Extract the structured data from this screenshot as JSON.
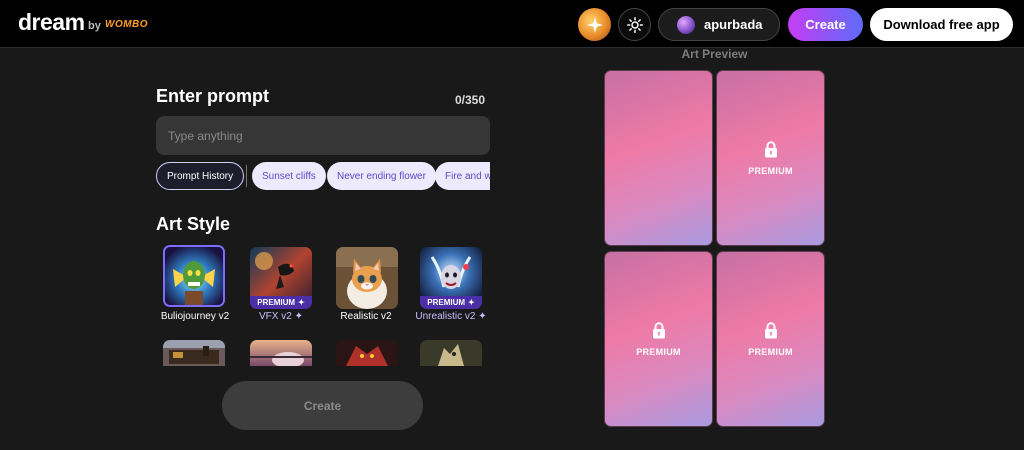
{
  "header": {
    "logo": "dream",
    "by": "by",
    "brand": "WOMBO",
    "username": "apurbada",
    "create_label": "Create",
    "download_label": "Download free app",
    "icons": [
      "sparkle-gem-icon",
      "sun-icon",
      "avatar"
    ]
  },
  "prompt": {
    "title": "Enter prompt",
    "counter": "0/350",
    "placeholder": "Type anything"
  },
  "chips": {
    "history": "Prompt History",
    "suggestions": [
      "Sunset cliffs",
      "Never ending flower",
      "Fire and w"
    ]
  },
  "art_style": {
    "title": "Art Style",
    "premium_label": "PREMIUM",
    "styles": [
      {
        "name": "Buliojourney v2",
        "premium": false,
        "selected": true
      },
      {
        "name": "VFX v2",
        "premium": true,
        "selected": false
      },
      {
        "name": "Realistic v2",
        "premium": false,
        "selected": false
      },
      {
        "name": "Unrealistic v2",
        "premium": true,
        "selected": false
      }
    ]
  },
  "create_button": "Create",
  "preview": {
    "title": "Art Preview",
    "cards": [
      {
        "locked": false,
        "label": ""
      },
      {
        "locked": true,
        "label": "PREMIUM"
      },
      {
        "locked": true,
        "label": "PREMIUM"
      },
      {
        "locked": true,
        "label": "PREMIUM"
      }
    ]
  },
  "colors": {
    "accent_purple": "#7c6cff",
    "create_gradient_start": "#c63df5",
    "create_gradient_end": "#5d6cf7",
    "premium_tag": "#4b2fa6"
  }
}
